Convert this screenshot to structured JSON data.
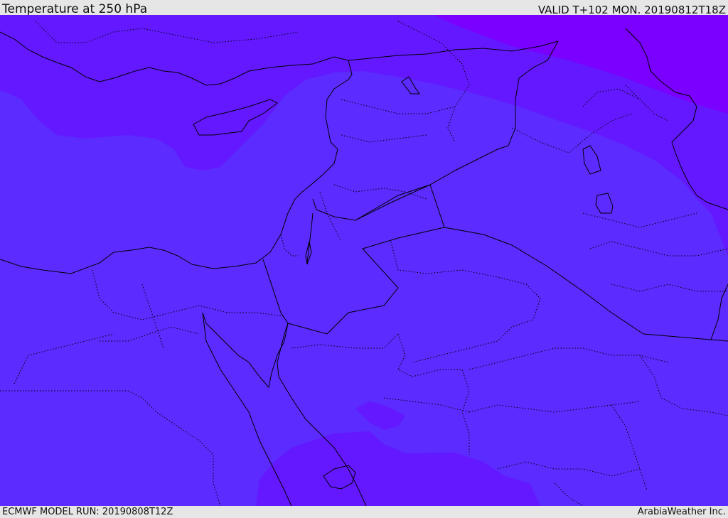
{
  "header": {
    "title": "Temperature at 250 hPa",
    "valid_time": "VALID T+102 MON. 20190812T18Z"
  },
  "footer": {
    "model_run": "ECMWF MODEL RUN: 20190808T12Z",
    "credit": "ArabiaWeather Inc."
  },
  "map": {
    "colors": {
      "band_base": "#5b2bff",
      "band_warm": "#6418ff",
      "band_warmest": "#7a00ff",
      "border_line": "#000000"
    }
  }
}
